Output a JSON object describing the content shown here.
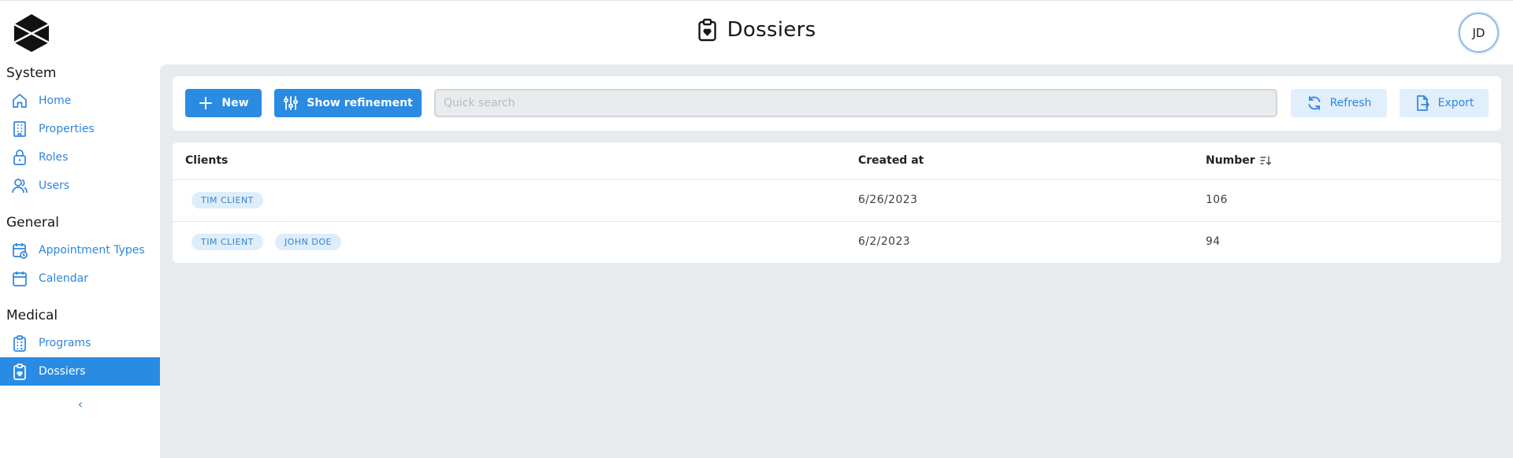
{
  "header": {
    "title": "Dossiers",
    "avatar_initials": "JD"
  },
  "sidebar": {
    "sections": [
      {
        "title": "System",
        "items": [
          {
            "label": "Home",
            "icon": "home-icon"
          },
          {
            "label": "Properties",
            "icon": "building-icon"
          },
          {
            "label": "Roles",
            "icon": "lock-icon"
          },
          {
            "label": "Users",
            "icon": "users-icon"
          }
        ]
      },
      {
        "title": "General",
        "items": [
          {
            "label": "Appointment Types",
            "icon": "calendar-clock-icon"
          },
          {
            "label": "Calendar",
            "icon": "calendar-icon"
          }
        ]
      },
      {
        "title": "Medical",
        "items": [
          {
            "label": "Programs",
            "icon": "clipboard-list-icon"
          },
          {
            "label": "Dossiers",
            "icon": "clipboard-heart-icon",
            "active": true
          }
        ]
      }
    ],
    "collapse_glyph": "‹"
  },
  "toolbar": {
    "new_label": "New",
    "refinement_label": "Show refinement",
    "search_placeholder": "Quick search",
    "refresh_label": "Refresh",
    "export_label": "Export"
  },
  "table": {
    "columns": [
      "Clients",
      "Created at",
      "Number"
    ],
    "rows": [
      {
        "clients": [
          "TIM CLIENT"
        ],
        "created_at": "6/26/2023",
        "number": "106"
      },
      {
        "clients": [
          "TIM CLIENT",
          "JOHN DOE"
        ],
        "created_at": "6/2/2023",
        "number": "94"
      }
    ]
  },
  "colors": {
    "accent": "#2a8be3",
    "accent_light": "#e1eefb",
    "background": "#e7ebee"
  }
}
